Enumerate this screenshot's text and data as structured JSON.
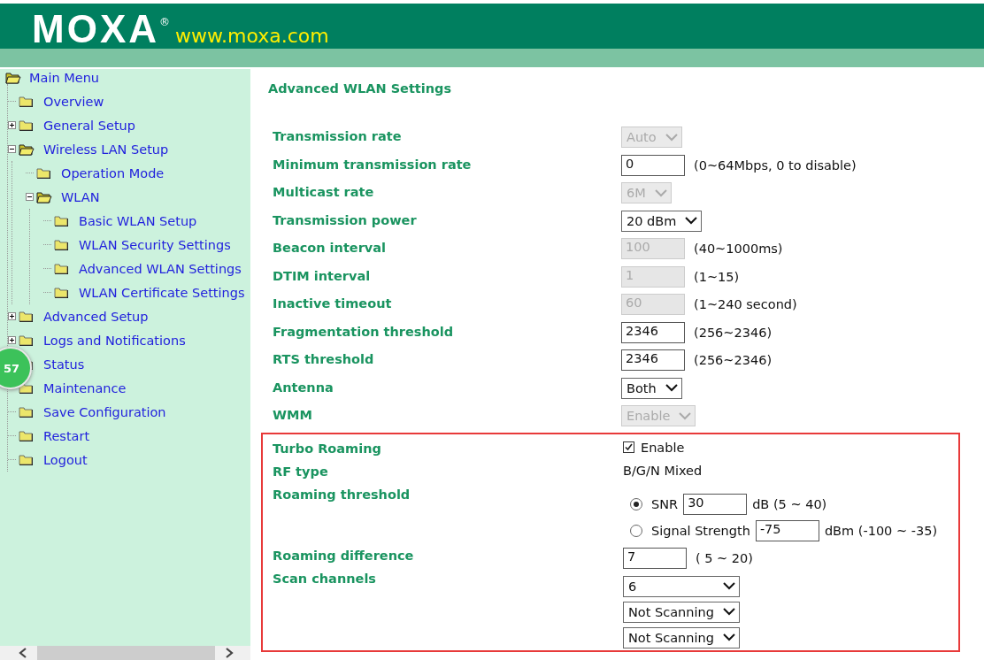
{
  "header": {
    "logo": "MOXA",
    "registered": "®",
    "url": "www.moxa.com"
  },
  "sidebar": {
    "badge": "57",
    "tree": [
      {
        "label": "Main Menu",
        "expanded": true,
        "children": [
          {
            "label": "Overview"
          },
          {
            "label": "General Setup",
            "expanded": false
          },
          {
            "label": "Wireless LAN Setup",
            "expanded": true,
            "children": [
              {
                "label": "Operation Mode"
              },
              {
                "label": "WLAN",
                "expanded": true,
                "children": [
                  {
                    "label": "Basic WLAN Setup"
                  },
                  {
                    "label": "WLAN Security Settings"
                  },
                  {
                    "label": "Advanced WLAN Settings"
                  },
                  {
                    "label": "WLAN Certificate Settings"
                  }
                ]
              }
            ]
          },
          {
            "label": "Advanced Setup",
            "expanded": false
          },
          {
            "label": "Logs and Notifications",
            "expanded": false
          },
          {
            "label": "Status"
          },
          {
            "label": "Maintenance"
          },
          {
            "label": "Save Configuration"
          },
          {
            "label": "Restart"
          },
          {
            "label": "Logout"
          }
        ]
      }
    ]
  },
  "page_title": "Advanced WLAN Settings",
  "settings": [
    {
      "label": "Transmission rate",
      "kind": "select",
      "value": "Auto",
      "disabled": true
    },
    {
      "label": "Minimum transmission rate",
      "kind": "input",
      "value": "0",
      "disabled": false,
      "hint": "(0~64Mbps, 0 to disable)"
    },
    {
      "label": "Multicast rate",
      "kind": "select",
      "value": "6M",
      "disabled": true
    },
    {
      "label": "Transmission power",
      "kind": "select",
      "value": "20 dBm",
      "disabled": false
    },
    {
      "label": "Beacon interval",
      "kind": "input",
      "value": "100",
      "disabled": true,
      "hint": "(40~1000ms)"
    },
    {
      "label": "DTIM interval",
      "kind": "input",
      "value": "1",
      "disabled": true,
      "hint": "(1~15)"
    },
    {
      "label": "Inactive timeout",
      "kind": "input",
      "value": "60",
      "disabled": true,
      "hint": "(1~240 second)"
    },
    {
      "label": "Fragmentation threshold",
      "kind": "input",
      "value": "2346",
      "disabled": false,
      "hint": "(256~2346)"
    },
    {
      "label": "RTS threshold",
      "kind": "input",
      "value": "2346",
      "disabled": false,
      "hint": "(256~2346)"
    },
    {
      "label": "Antenna",
      "kind": "select",
      "value": "Both",
      "disabled": false
    },
    {
      "label": "WMM",
      "kind": "select",
      "value": "Enable",
      "disabled": true
    }
  ],
  "roaming_settings": [
    {
      "label": "Turbo Roaming",
      "kind": "checkbox",
      "checked": true,
      "text": "Enable"
    },
    {
      "label": "RF type",
      "kind": "text",
      "value": "B/G/N Mixed"
    },
    {
      "label": "Roaming threshold",
      "kind": "radio",
      "options": [
        {
          "label": "SNR",
          "selected": true,
          "value": "30",
          "unit": "dB (5 ~ 40)"
        },
        {
          "label": "Signal Strength",
          "selected": false,
          "value": "-75",
          "unit": "dBm (-100 ~ -35)"
        }
      ]
    },
    {
      "label": "Roaming difference",
      "kind": "input",
      "value": "7",
      "disabled": false,
      "hint": "( 5 ~ 20)"
    },
    {
      "label": "Scan channels",
      "kind": "selects",
      "values": [
        "6",
        "Not Scanning",
        "Not Scanning"
      ]
    }
  ]
}
